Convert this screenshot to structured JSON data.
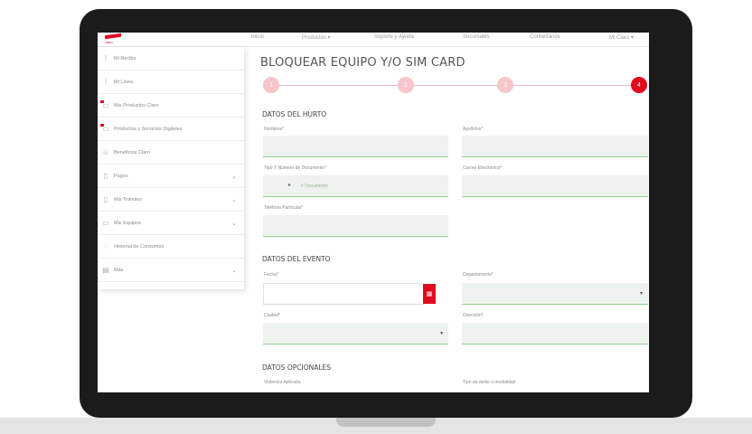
{
  "brand": {
    "logo": "claro-logo",
    "tagline": "claro"
  },
  "nav": [
    "Inicio",
    "Productos ▾",
    "Soporte y Ayuda",
    "Sucursales",
    "Contactanos",
    "Mi Claro ▾"
  ],
  "sidebar": {
    "items": [
      {
        "label": "Mi Recibo",
        "icon": "receipt-icon",
        "chevron": ""
      },
      {
        "label": "Mi Línea",
        "icon": "phone-icon",
        "chevron": ""
      },
      {
        "label": "Mis Productos Claro",
        "icon": "products-icon",
        "chevron": ""
      },
      {
        "label": "Productos y Servicios Digitales",
        "icon": "digital-icon",
        "chevron": ""
      },
      {
        "label": "Beneficios Claro",
        "icon": "gift-icon",
        "chevron": ""
      },
      {
        "label": "Pagos",
        "icon": "document-icon",
        "chevron": "⌄"
      },
      {
        "label": "Mis Trámites",
        "icon": "clipboard-icon",
        "chevron": "⌄"
      },
      {
        "label": "Mis Equipos",
        "icon": "device-icon",
        "chevron": "⌄"
      },
      {
        "label": "Historial de Consumos",
        "icon": "history-icon",
        "chevron": ""
      },
      {
        "label": "Más",
        "icon": "more-icon",
        "chevron": "⌄"
      }
    ]
  },
  "page": {
    "title": "BLOQUEAR EQUIPO Y/O SIM CARD"
  },
  "stepper": {
    "steps": [
      "1",
      "2",
      "3",
      "4"
    ],
    "active": 4
  },
  "section_theft": {
    "heading": "DATOS DEL HURTO",
    "labels": {
      "nombres": "Nombres*",
      "apellidos": "Apellidos*",
      "tipo_doc": "Tipo Y Número de Documento*",
      "correo": "Correo Electrónico*",
      "telefono": "Teléfono Particular*"
    },
    "tipo_doc_placeholder": "# Documento"
  },
  "section_event": {
    "heading": "DATOS DEL EVENTO",
    "labels": {
      "fecha": "Fecha*",
      "departamento": "Departamento*",
      "ciudad": "Ciudad*",
      "direccion": "Dirección*"
    }
  },
  "section_optional": {
    "heading": "DATOS OPCIONALES",
    "labels": {
      "violencia": "Violencia Aplicada",
      "tipo_delito": "Tipo de delito o modalidad"
    }
  },
  "colors": {
    "accent": "#e10a1e",
    "field_bg": "#eef2ee",
    "field_line": "#8fd28b"
  }
}
